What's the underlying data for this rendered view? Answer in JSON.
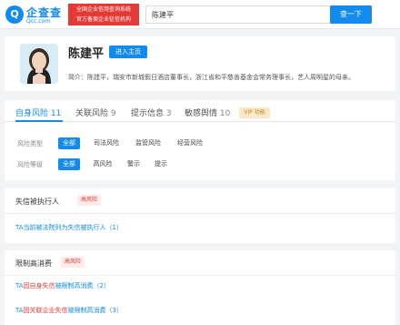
{
  "header": {
    "logo_mark": "Q",
    "logo_text": "企查查",
    "logo_sub": "Qcc.com",
    "tag_line1": "全国企业信用查询系统",
    "tag_line2": "官方备案企业征信机构",
    "search_value": "陈建平",
    "clear_icon": "×",
    "search_button": "查一下"
  },
  "person": {
    "name": "陈建平",
    "home_button": "进入主页",
    "intro": "简介：陈建平，瑞安市新城假日酒店董事长，浙江省和平慈善基金会常务理事长，艺人周明星的母亲。"
  },
  "tabs": [
    {
      "label": "自身风险",
      "count": "11"
    },
    {
      "label": "关联风险",
      "count": "9"
    },
    {
      "label": "提示信息",
      "count": "3"
    },
    {
      "label": "敏感舆情",
      "count": "10"
    }
  ],
  "vip_label": "VIP 功能",
  "filters": {
    "type_label": "风险类型",
    "type_options": [
      "全部",
      "司法风险",
      "监管风险",
      "经营风险"
    ],
    "level_label": "风险等级",
    "level_options": [
      "全部",
      "高风险",
      "警示",
      "提示"
    ]
  },
  "sections": {
    "s1": {
      "title": "失信被执行人",
      "badge": "高风险",
      "item_text": "TA当前被法院列为失信被执行人",
      "item_count": "（1）"
    },
    "s2": {
      "title": "限制高消费",
      "badge": "高风险",
      "item1_prefix": "TA",
      "item1_red": "因自身失信",
      "item1_suffix": "被限制高消费",
      "item1_count": "（2）",
      "item2_prefix": "TA",
      "item2_red": "因关联企业失信",
      "item2_suffix": "被限制高消费",
      "item2_count": "（3）"
    }
  },
  "colors": {
    "accent": "#128bed",
    "risk": "#e53935"
  }
}
